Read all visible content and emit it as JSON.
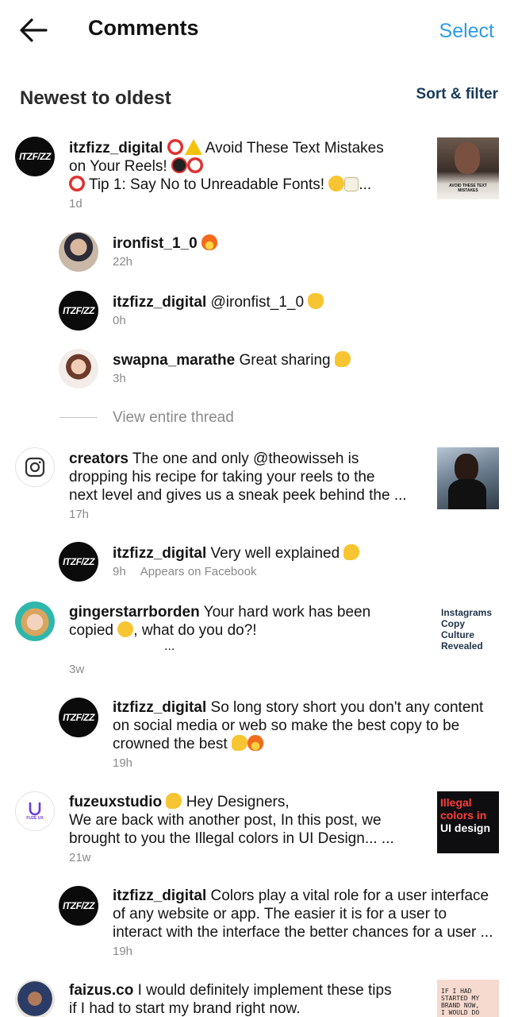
{
  "header": {
    "title": "Comments",
    "select_label": "Select"
  },
  "sort": {
    "title": "Newest to oldest",
    "filter_label": "Sort & filter"
  },
  "comments": [
    {
      "username": "itzfizz_digital",
      "lines": [
        "Avoid These Text Mistakes",
        "on Your Reels!",
        "Tip 1: Say No to Unreadable Fonts!"
      ],
      "ellipsis": "...",
      "time": "1d",
      "avatar_text": "ITZF/ZZ",
      "thumb_text": "AVOID THESE TEXT MISTAKES"
    },
    {
      "username": "ironfist_1_0",
      "text": "",
      "time": "22h"
    },
    {
      "username": "itzfizz_digital",
      "text": "@ironfist_1_0",
      "time": "0h",
      "avatar_text": "ITZF/ZZ"
    },
    {
      "username": "swapna_marathe",
      "text": "Great sharing",
      "time": "3h"
    },
    {
      "username": "creators",
      "lines": [
        "The one and only @theowisseh is",
        "dropping his recipe for taking your reels to the",
        "next level and gives us a sneak peek behind the ..."
      ],
      "time": "17h"
    },
    {
      "username": "itzfizz_digital",
      "text": "Very well explained",
      "time": "9h",
      "extra": "Appears on Facebook",
      "avatar_text": "ITZF/ZZ"
    },
    {
      "username": "gingerstarrborden",
      "lines": [
        "Your hard work has been",
        "copied",
        ", what do you do?!",
        "..."
      ],
      "time": "3w",
      "thumb_lines": [
        "Instagrams",
        "Copy",
        "Culture",
        "Revealed"
      ]
    },
    {
      "username": "itzfizz_digital",
      "lines": [
        "So long story short you don't any content",
        "on social media or web so make the best copy to be",
        "crowned the best"
      ],
      "time": "19h",
      "avatar_text": "ITZF/ZZ"
    },
    {
      "username": "fuzeuxstudio",
      "lines": [
        "Hey Designers,",
        "We are back with another post, In this post, we",
        "brought to you the Illegal colors in UI Design... ..."
      ],
      "time": "21w",
      "avatar_text": "FUZE UX",
      "thumb_lines": [
        "Illegal",
        "colors in",
        "UI design"
      ]
    },
    {
      "username": "itzfizz_digital",
      "lines": [
        "Colors play a vital role for a user interface",
        "of any website or app. The easier it is for a user to",
        "interact with the interface the better chances for a user ..."
      ],
      "time": "19h",
      "avatar_text": "ITZF/ZZ"
    },
    {
      "username": "faizus.co",
      "lines": [
        "I would definitely implement these tips",
        "if I had to start my brand right now."
      ],
      "thumb_lines": [
        "IF I HAD",
        "STARTED MY",
        "BRAND NOW,",
        "I WOULD DO"
      ]
    }
  ],
  "thread": {
    "view_label": "View entire thread"
  },
  "colors": {
    "accent": "#2d9be8",
    "sort_filter": "#173a59",
    "meta": "#8a8a8a"
  },
  "icons": [
    "back-arrow-icon",
    "no-entry-icon",
    "warning-icon",
    "fire-icon",
    "raised-hands-icon",
    "clap-icon",
    "weary-face-icon",
    "memo-icon",
    "instagram-icon"
  ]
}
